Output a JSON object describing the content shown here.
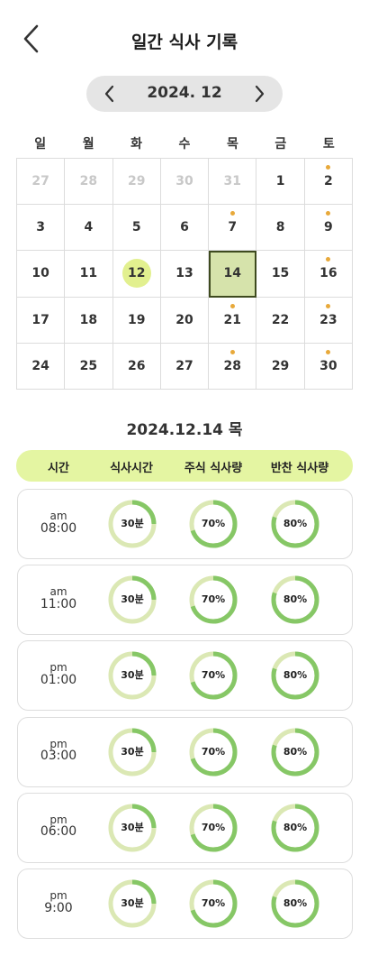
{
  "header": {
    "title": "일간 식사 기록",
    "back_icon": "chevron-left-icon"
  },
  "month_nav": {
    "label": "2024. 12",
    "prev_icon": "chevron-left-icon",
    "next_icon": "chevron-right-icon"
  },
  "weekdays": [
    "일",
    "월",
    "화",
    "수",
    "목",
    "금",
    "토"
  ],
  "calendar": {
    "days": [
      {
        "label": "27",
        "muted": true,
        "dot": false
      },
      {
        "label": "28",
        "muted": true,
        "dot": false
      },
      {
        "label": "29",
        "muted": true,
        "dot": false
      },
      {
        "label": "30",
        "muted": true,
        "dot": false
      },
      {
        "label": "31",
        "muted": true,
        "dot": false
      },
      {
        "label": "1",
        "muted": false,
        "dot": false
      },
      {
        "label": "2",
        "muted": false,
        "dot": true
      },
      {
        "label": "3",
        "muted": false,
        "dot": false
      },
      {
        "label": "4",
        "muted": false,
        "dot": false
      },
      {
        "label": "5",
        "muted": false,
        "dot": false
      },
      {
        "label": "6",
        "muted": false,
        "dot": false
      },
      {
        "label": "7",
        "muted": false,
        "dot": true
      },
      {
        "label": "8",
        "muted": false,
        "dot": false
      },
      {
        "label": "9",
        "muted": false,
        "dot": true
      },
      {
        "label": "10",
        "muted": false,
        "dot": false
      },
      {
        "label": "11",
        "muted": false,
        "dot": false
      },
      {
        "label": "12",
        "muted": false,
        "dot": false,
        "today": true
      },
      {
        "label": "13",
        "muted": false,
        "dot": false
      },
      {
        "label": "14",
        "muted": false,
        "dot": false,
        "selected": true
      },
      {
        "label": "15",
        "muted": false,
        "dot": false
      },
      {
        "label": "16",
        "muted": false,
        "dot": true
      },
      {
        "label": "17",
        "muted": false,
        "dot": false
      },
      {
        "label": "18",
        "muted": false,
        "dot": false
      },
      {
        "label": "19",
        "muted": false,
        "dot": false
      },
      {
        "label": "20",
        "muted": false,
        "dot": false
      },
      {
        "label": "21",
        "muted": false,
        "dot": true
      },
      {
        "label": "22",
        "muted": false,
        "dot": false
      },
      {
        "label": "23",
        "muted": false,
        "dot": true
      },
      {
        "label": "24",
        "muted": false,
        "dot": false
      },
      {
        "label": "25",
        "muted": false,
        "dot": false
      },
      {
        "label": "26",
        "muted": false,
        "dot": false
      },
      {
        "label": "27",
        "muted": false,
        "dot": false
      },
      {
        "label": "28",
        "muted": false,
        "dot": true
      },
      {
        "label": "29",
        "muted": false,
        "dot": false
      },
      {
        "label": "30",
        "muted": false,
        "dot": true
      }
    ]
  },
  "selected_date": "2024.12.14 목",
  "table": {
    "headers": [
      "시간",
      "식사시간",
      "주식 식사량",
      "반찬 식사량"
    ],
    "rows": [
      {
        "ampm": "am",
        "time": "08:00",
        "duration": {
          "label": "30분",
          "fraction": 0.25
        },
        "main": {
          "label": "70%",
          "fraction": 0.7
        },
        "side": {
          "label": "80%",
          "fraction": 0.8
        }
      },
      {
        "ampm": "am",
        "time": "11:00",
        "duration": {
          "label": "30분",
          "fraction": 0.25
        },
        "main": {
          "label": "70%",
          "fraction": 0.7
        },
        "side": {
          "label": "80%",
          "fraction": 0.8
        }
      },
      {
        "ampm": "pm",
        "time": "01:00",
        "duration": {
          "label": "30분",
          "fraction": 0.25
        },
        "main": {
          "label": "70%",
          "fraction": 0.7
        },
        "side": {
          "label": "80%",
          "fraction": 0.8
        }
      },
      {
        "ampm": "pm",
        "time": "03:00",
        "duration": {
          "label": "30분",
          "fraction": 0.25
        },
        "main": {
          "label": "70%",
          "fraction": 0.7
        },
        "side": {
          "label": "80%",
          "fraction": 0.8
        }
      },
      {
        "ampm": "pm",
        "time": "06:00",
        "duration": {
          "label": "30분",
          "fraction": 0.25
        },
        "main": {
          "label": "70%",
          "fraction": 0.7
        },
        "side": {
          "label": "80%",
          "fraction": 0.8
        }
      },
      {
        "ampm": "pm",
        "time": "9:00",
        "duration": {
          "label": "30분",
          "fraction": 0.25
        },
        "main": {
          "label": "70%",
          "fraction": 0.7
        },
        "side": {
          "label": "80%",
          "fraction": 0.8
        }
      }
    ]
  },
  "colors": {
    "ring_track": "#dbe8b4",
    "ring_fill": "#86c766",
    "event_dot": "#e8a93a",
    "today_bg": "#e2f08f",
    "selected_bg": "#d6e3ab",
    "header_bar": "#e4f5a2"
  }
}
